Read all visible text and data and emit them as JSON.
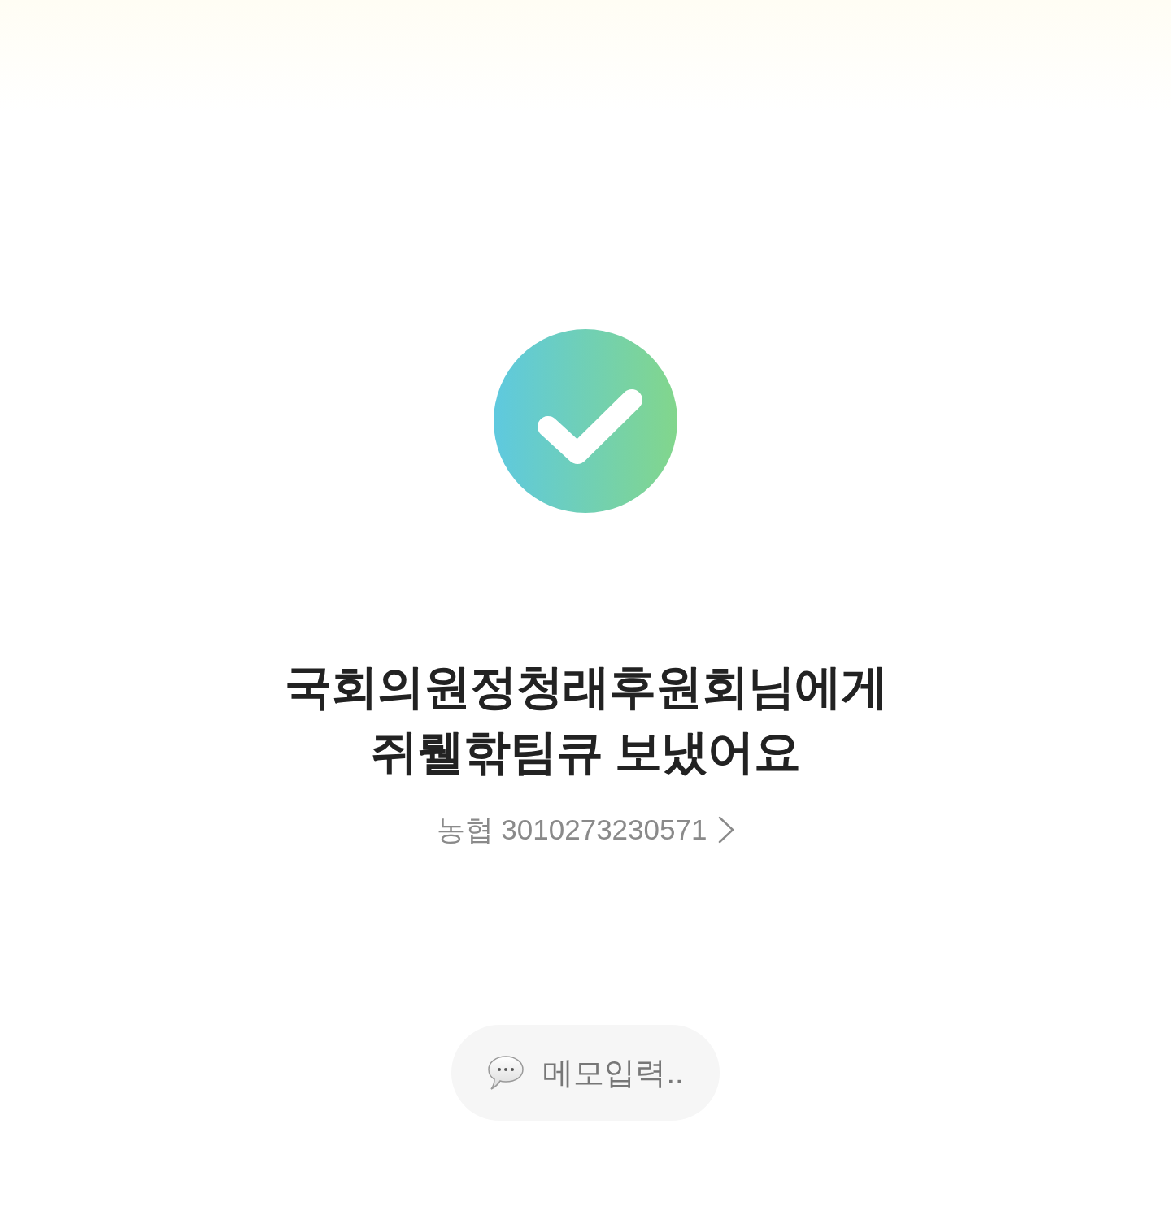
{
  "title": [
    "국회의원정청래후원회님에게",
    "쥐뤨핚팀큐 보냈어요"
  ],
  "account": {
    "label": "농협 3010273230571"
  },
  "memo": {
    "label": "메모입력.."
  }
}
